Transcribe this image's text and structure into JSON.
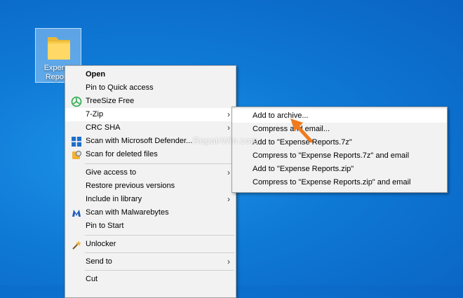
{
  "desktop_icon": {
    "label": "Expense\nReports"
  },
  "context_menu": {
    "items": [
      {
        "label": "Open"
      },
      {
        "label": "Pin to Quick access"
      },
      {
        "label": "TreeSize Free"
      },
      {
        "label": "7-Zip"
      },
      {
        "label": "CRC SHA"
      },
      {
        "label": "Scan with Microsoft Defender..."
      },
      {
        "label": "Scan for deleted files"
      },
      {
        "label": "Give access to"
      },
      {
        "label": "Restore previous versions"
      },
      {
        "label": "Include in library"
      },
      {
        "label": "Scan with Malwarebytes"
      },
      {
        "label": "Pin to Start"
      },
      {
        "label": "Unlocker"
      },
      {
        "label": "Send to"
      },
      {
        "label": "Cut"
      }
    ]
  },
  "submenu_7zip": {
    "items": [
      {
        "label": "Add to archive..."
      },
      {
        "label": "Compress and email..."
      },
      {
        "label": "Add to \"Expense Reports.7z\""
      },
      {
        "label": "Compress to \"Expense Reports.7z\" and email"
      },
      {
        "label": "Add to \"Expense Reports.zip\""
      },
      {
        "label": "Compress to \"Expense Reports.zip\" and email"
      }
    ]
  },
  "watermark": "RepairWin.com",
  "colors": {
    "desktop": "#0f79d6",
    "menu_bg": "#f2f2f2",
    "highlight": "#ffffff",
    "arrow": "#f07a1c"
  }
}
